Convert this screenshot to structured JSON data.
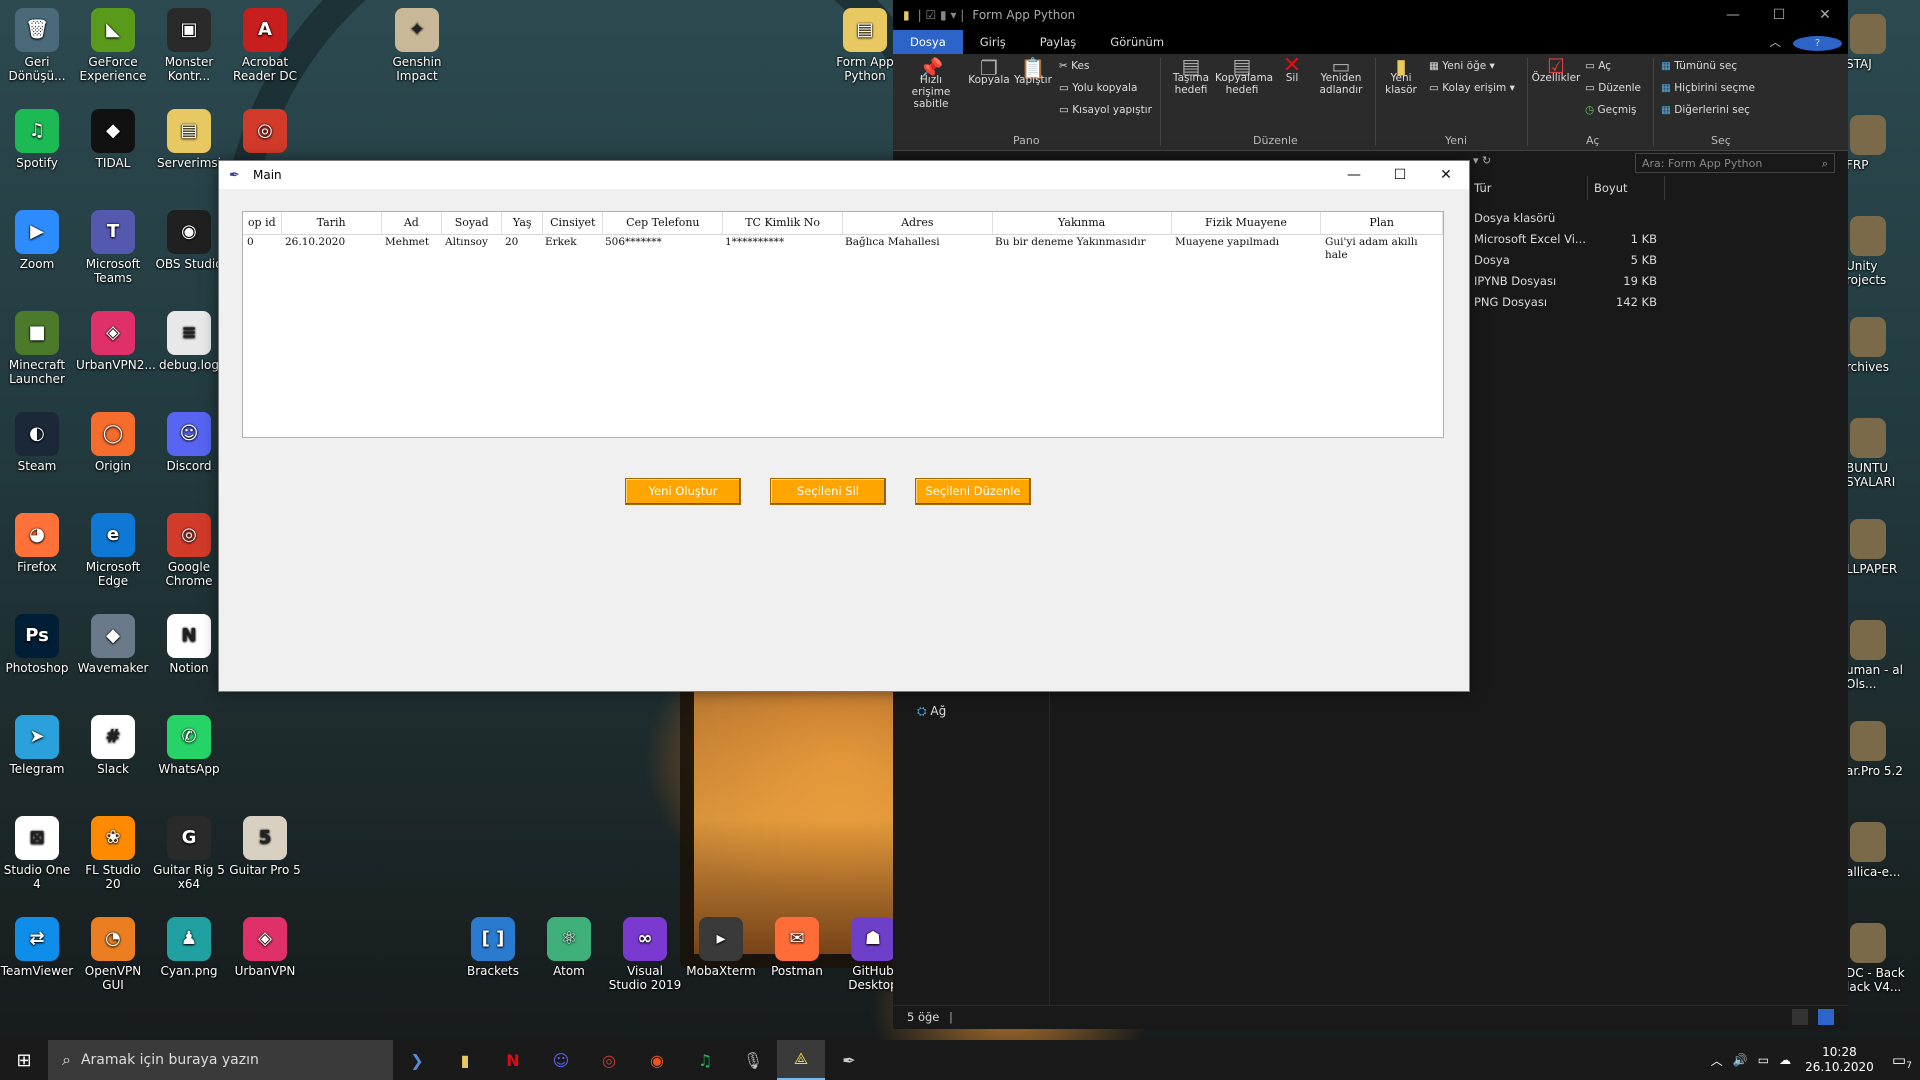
{
  "desktop": {
    "icons": [
      {
        "label": "Geri Dönüşü...",
        "glyph": "🗑",
        "color": "#4a6a7a"
      },
      {
        "label": "GeForce Experience",
        "glyph": "◣",
        "color": "#5a9a1a"
      },
      {
        "label": "Monster Kontr...",
        "glyph": "▣",
        "color": "#2a2a2a"
      },
      {
        "label": "Acrobat Reader DC",
        "glyph": "A",
        "color": "#c81e1e"
      },
      {
        "label": "Genshin Impact",
        "glyph": "✦",
        "color": "#c8b898"
      },
      {
        "label": "Form App Python",
        "glyph": "▤",
        "color": "#e8c860"
      },
      {
        "label": "Spotify",
        "glyph": "♫",
        "color": "#1db954"
      },
      {
        "label": "TIDAL",
        "glyph": "◆",
        "color": "#111111"
      },
      {
        "label": "Serverimsi",
        "glyph": "▤",
        "color": "#e8c860"
      },
      {
        "label": "",
        "glyph": "◎",
        "color": "#d23a2a"
      },
      {
        "label": "Zoom",
        "glyph": "▶",
        "color": "#2d8cff"
      },
      {
        "label": "Microsoft Teams",
        "glyph": "T",
        "color": "#5558af"
      },
      {
        "label": "OBS Studio",
        "glyph": "◉",
        "color": "#202020"
      },
      {
        "label": "Minecraft Launcher",
        "glyph": "■",
        "color": "#4a7a2a"
      },
      {
        "label": "UrbanVPN2...",
        "glyph": "◈",
        "color": "#e0306a"
      },
      {
        "label": "debug.log",
        "glyph": "≡",
        "color": "#e8e8e8"
      },
      {
        "label": "Steam",
        "glyph": "◐",
        "color": "#1b2838"
      },
      {
        "label": "Origin",
        "glyph": "◯",
        "color": "#f56c2d"
      },
      {
        "label": "Discord",
        "glyph": "☺",
        "color": "#5865f2"
      },
      {
        "label": "Firefox",
        "glyph": "◕",
        "color": "#ff7139"
      },
      {
        "label": "Microsoft Edge",
        "glyph": "e",
        "color": "#0f78d4"
      },
      {
        "label": "Google Chrome",
        "glyph": "◎",
        "color": "#d23a2a"
      },
      {
        "label": "Photoshop",
        "glyph": "Ps",
        "color": "#001e36"
      },
      {
        "label": "Wavemaker",
        "glyph": "◆",
        "color": "#6a7a8a"
      },
      {
        "label": "Notion",
        "glyph": "N",
        "color": "#ffffff"
      },
      {
        "label": "Telegram",
        "glyph": "➤",
        "color": "#2aa1da"
      },
      {
        "label": "Slack",
        "glyph": "#",
        "color": "#ffffff"
      },
      {
        "label": "WhatsApp",
        "glyph": "✆",
        "color": "#25d366"
      },
      {
        "label": "Studio One 4",
        "glyph": "⊠",
        "color": "#ffffff"
      },
      {
        "label": "FL Studio 20",
        "glyph": "❀",
        "color": "#ff8a00"
      },
      {
        "label": "Guitar Rig 5 x64",
        "glyph": "G",
        "color": "#2a2a2a"
      },
      {
        "label": "Guitar Pro 5",
        "glyph": "5",
        "color": "#d8d0c0"
      },
      {
        "label": "TeamViewer",
        "glyph": "⇄",
        "color": "#0e8ee9"
      },
      {
        "label": "OpenVPN GUI",
        "glyph": "◔",
        "color": "#ea7e20"
      },
      {
        "label": "Cyan.png",
        "glyph": "♟",
        "color": "#20a0a0"
      },
      {
        "label": "UrbanVPN",
        "glyph": "◈",
        "color": "#e0306a"
      },
      {
        "label": "Brackets",
        "glyph": "[ ]",
        "color": "#2a7ad0"
      },
      {
        "label": "Atom",
        "glyph": "⚛",
        "color": "#40b07a"
      },
      {
        "label": "Visual Studio 2019",
        "glyph": "∞",
        "color": "#7a3ad0"
      },
      {
        "label": "MobaXterm",
        "glyph": "▸",
        "color": "#3a3a3a"
      },
      {
        "label": "Postman",
        "glyph": "✉",
        "color": "#ff6c37"
      },
      {
        "label": "GitHub Desktop",
        "glyph": "☗",
        "color": "#6e40c9"
      }
    ],
    "right_icons": [
      {
        "label": "STAJ"
      },
      {
        "label": "FRP"
      },
      {
        "label": "Unity rojects"
      },
      {
        "label": "rchives"
      },
      {
        "label": "BUNTU SYALARI"
      },
      {
        "label": "LLPAPER"
      },
      {
        "label": "uman - al Ols..."
      },
      {
        "label": "ar.Pro 5.2"
      },
      {
        "label": "allica-e..."
      },
      {
        "label": "DC - Back lack V4..."
      }
    ]
  },
  "tk_window": {
    "title": "Main",
    "columns": [
      "op id",
      "Tarih",
      "Ad",
      "Soyad",
      "Yaş",
      "Cinsiyet",
      "Cep Telefonu",
      "TC Kimlik No",
      "Adres",
      "Yakınma",
      "Fizik Muayene",
      "Plan"
    ],
    "rows": [
      [
        "0",
        "26.10.2020",
        "Mehmet",
        "Altınsoy",
        "20",
        "Erkek",
        "506*******",
        "1**********",
        "Bağlıca Mahallesi",
        "Bu bir deneme Yakınmasıdır",
        "Muayene yapılmadı",
        "Gui'yi adam akıllı hale"
      ]
    ],
    "buttons": {
      "new": "Yeni Oluştur",
      "delete": "Seçileni Sil",
      "edit": "Seçileni Düzenle"
    },
    "accent": "#ffa500"
  },
  "explorer": {
    "title": "Form App Python",
    "tabs": [
      "Dosya",
      "Giriş",
      "Paylaş",
      "Görünüm"
    ],
    "ribbon": {
      "pin": "Hızlı erişime sabitle",
      "copy": "Kopyala",
      "paste": "Yapıştır",
      "cut": "Kes",
      "copy_path": "Yolu kopyala",
      "paste_shortcut": "Kısayol yapıştır",
      "move_to": "Taşıma hedefi",
      "copy_to": "Kopyalama hedefi",
      "delete": "Sil",
      "rename": "Yeniden adlandır",
      "new_folder": "Yeni klasör",
      "new_item": "Yeni öğe",
      "easy_access": "Kolay erişim",
      "properties": "Özellikler",
      "open": "Aç",
      "edit": "Düzenle",
      "history": "Geçmiş",
      "select_all": "Tümünü seç",
      "select_none": "Hiçbirini seçme",
      "invert": "Diğerlerini seç",
      "groups": {
        "clipboard": "Pano",
        "organize": "Düzenle",
        "new": "Yeni",
        "open": "Aç",
        "select": "Seç"
      }
    },
    "search_placeholder": "Ara: Form App Python",
    "columns": {
      "type": "Tür",
      "size": "Boyut"
    },
    "files": [
      {
        "type": "Dosya klasörü",
        "size": ""
      },
      {
        "type": "Microsoft Excel Vi...",
        "size": "1 KB"
      },
      {
        "type": "Dosya",
        "size": "5 KB"
      },
      {
        "type": "IPYNB Dosyası",
        "size": "19 KB"
      },
      {
        "type": "PNG Dosyası",
        "size": "142 KB"
      }
    ],
    "nav_network": "Ağ",
    "status": "5 öğe"
  },
  "taskbar": {
    "search_placeholder": "Aramak için buraya yazın",
    "time": "10:28",
    "date": "26.10.2020",
    "notification_count": "7"
  }
}
